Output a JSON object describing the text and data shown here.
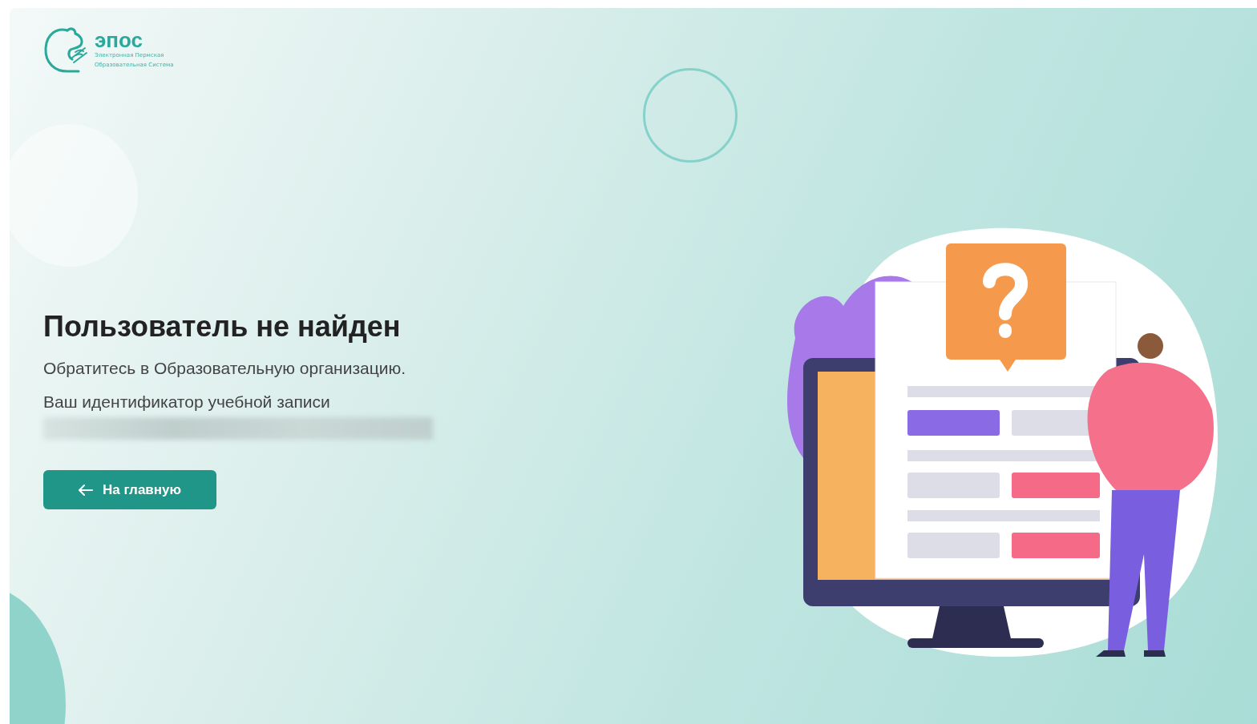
{
  "logo": {
    "name": "эпос",
    "subtitle_line_1": "Электронная Пермская",
    "subtitle_line_2": "Образовательная Система"
  },
  "heading": "Пользователь не найден",
  "message": "Обратитесь в Образовательную организацию.",
  "id_label": "Ваш идентификатор учебной записи",
  "id_value_redacted": true,
  "button": {
    "label": "На главную"
  }
}
